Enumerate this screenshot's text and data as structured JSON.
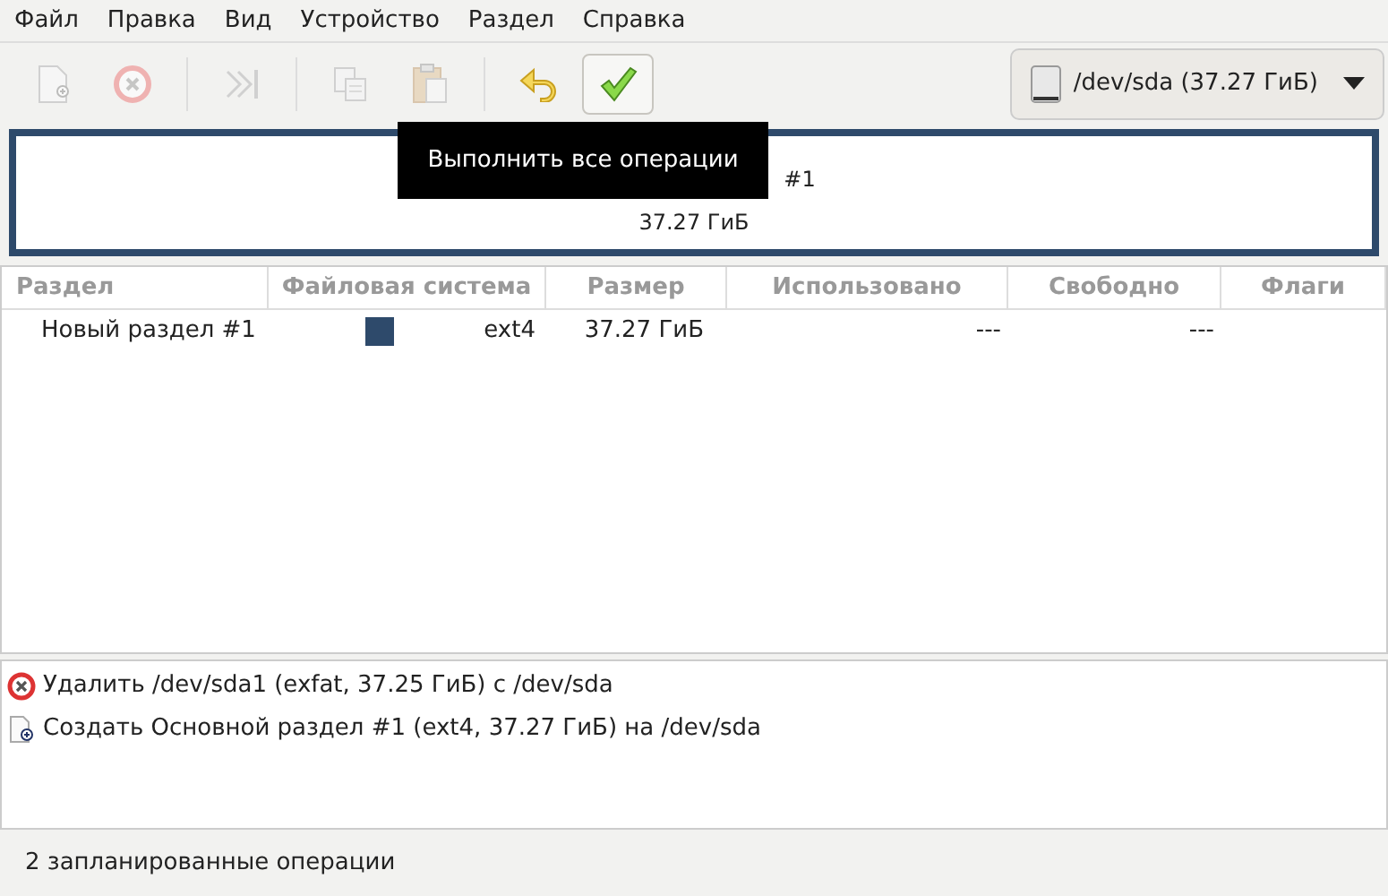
{
  "menu": [
    "Файл",
    "Правка",
    "Вид",
    "Устройство",
    "Раздел",
    "Справка"
  ],
  "toolbar": [
    {
      "kind": "new",
      "disabled": true,
      "hovered": false
    },
    {
      "kind": "delete",
      "disabled": true,
      "hovered": false
    },
    {
      "kind": "separator"
    },
    {
      "kind": "resize",
      "disabled": true,
      "hovered": false
    },
    {
      "kind": "separator"
    },
    {
      "kind": "copy",
      "disabled": true,
      "hovered": false
    },
    {
      "kind": "paste",
      "disabled": true,
      "hovered": false
    },
    {
      "kind": "separator"
    },
    {
      "kind": "undo",
      "disabled": false,
      "hovered": false
    },
    {
      "kind": "apply",
      "disabled": false,
      "hovered": true
    }
  ],
  "device": {
    "label": "/dev/sda (37.27 ГиБ)"
  },
  "map": {
    "name": "#1",
    "size": "37.27 ГиБ",
    "color": "#2e4a6b"
  },
  "tooltip": "Выполнить все операции",
  "table": {
    "columns": [
      "Раздел",
      "Файловая система",
      "Размер",
      "Использовано",
      "Свободно",
      "Флаги"
    ],
    "rows": [
      {
        "partition": "Новый раздел #1",
        "color": "#2e4a6b",
        "filesystem": "ext4",
        "size": "37.27 ГиБ",
        "used": "---",
        "free": "---"
      }
    ]
  },
  "operations": [
    {
      "kind": "delete",
      "text": "Удалить /dev/sda1 (exfat, 37.25 ГиБ) с /dev/sda"
    },
    {
      "kind": "create",
      "text": "Создать Основной раздел #1 (ext4, 37.27 ГиБ) на /dev/sda"
    }
  ],
  "status_bar": "2 запланированные операции"
}
